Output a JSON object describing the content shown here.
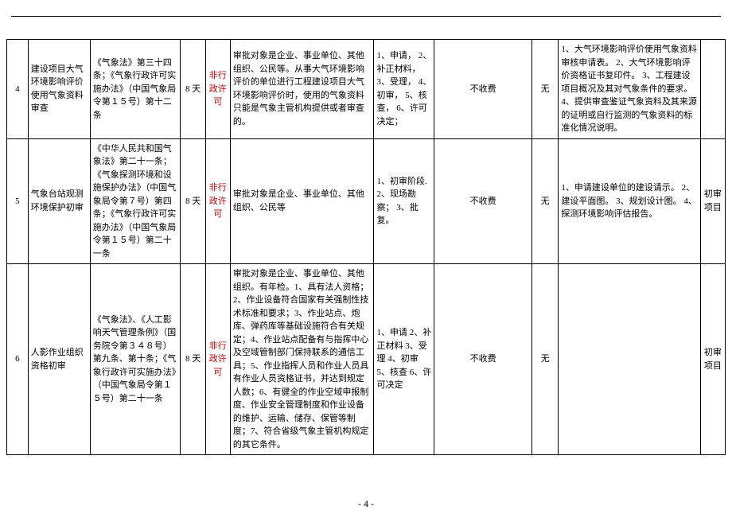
{
  "page_number": "- 4 -",
  "rows": [
    {
      "num": "4",
      "item": "建设项目大气环境影响评价使用气象资料审查",
      "basis": "《气象法》第三十四条；《气象行政许可实施办法》（中国气象局令第１５号）第十二条",
      "days": "8 天",
      "type": "非行政许可",
      "objects": "审批对象是企业、事业单位、其他组织、公民等。从事大气环境影响评价的单位进行工程建设项目大气环境影响评价时，使用的气象资料只能是气象主管机构提供或者审查的。",
      "procedure": "1、申请，\n2、补正材料，\n3、受理，\n4、初审，\n5、核查，\n6、许可决定；",
      "fee": "不收费",
      "charge_basis": "无",
      "materials": "1、大气环境影响评价使用气象资料审核申请表。\n2、大气环境影响评价资格证书复印件。\n3、工程建设项目概况及其对气象条件的要求。\n4、提供审查鉴证气象资料及其来源的证明或自行监测的气象资料的标准化情况说明。",
      "remark": ""
    },
    {
      "num": "5",
      "item": "气象台站观测环境保护初审",
      "basis": "《中华人民共和国气象法》第二十一条；《气象探测环境和设施保护办法》（中国气象局令第７号）第四条；《气象行政许可实施办法》（中国气象局令第１５号）第二十一条",
      "days": "8 天",
      "type": "非行政许可",
      "objects": "审批对象是企业、事业单位、其他组织、公民等",
      "procedure": "1、初审阶段.\n2、现场勘察；\n3、批复。",
      "fee": "不收费",
      "charge_basis": "无",
      "materials": "1、申请建设单位的建设请示。\n2、建设平面图。\n3、规划设计图。\n4、探测环境影响评估报告。",
      "remark": "初审项目"
    },
    {
      "num": "6",
      "item": "人影作业组织资格初审",
      "basis": "《气象法》、《人工影响天气管理条例》（国务院令第３４８号）第九条、第十条；《气象行政许可实施办法》（中国气象局令第１５号）第二十一条",
      "days": "8 天",
      "type": "非行政许可",
      "objects": "审批对象是企业、事业单位、其他组织。有年检。1、具有法人资格；2、作业设备符合国家有关强制性技术标准和要求；3、作业站点、炮库、弹药库等基础设施符合有关规定；4、作业站点配备有与指挥中心及空域管制部门保持联系的通信工具；5、作业指挥人员和作业人员具有作业人员资格证书，并达到规定人数；6、有健全的作业空域申报制度、作业安全管理制度和作业设备的维护、运输、储存、保管等制度；7、符合省级气象主管机构规定的其它条件。",
      "procedure": "1、申请\n2、补正材料\n3、受理\n4、初审\n5、核查\n6、许可决定",
      "fee": "不收费",
      "charge_basis": "无",
      "materials": "",
      "remark": "初审项目"
    }
  ]
}
